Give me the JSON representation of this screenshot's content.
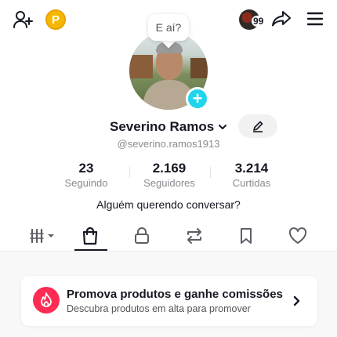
{
  "header": {
    "coin_symbol": "P",
    "story_count": "99",
    "icons": [
      "add-user-icon",
      "coin-icon",
      "share-icon",
      "menu-icon"
    ]
  },
  "profile": {
    "status_bubble": "E aí?",
    "name": "Severino Ramos",
    "username": "@severino.ramos1913",
    "bio": "Alguém querendo conversar?"
  },
  "stats": [
    {
      "value": "23",
      "label": "Seguindo"
    },
    {
      "value": "2.169",
      "label": "Seguidores"
    },
    {
      "value": "3.214",
      "label": "Curtidas"
    }
  ],
  "tabs": [
    "videos-grid-icon",
    "shop-bag-icon",
    "lock-icon",
    "repost-icon",
    "bookmark-icon",
    "heart-icon"
  ],
  "promo": {
    "title": "Promova produtos e ganhe comissões",
    "subtitle": "Descubra produtos em alta para promover"
  },
  "colors": {
    "accent_blue": "#20d5ec",
    "brand_red": "#fe2c55",
    "coin_yellow": "#f5b800",
    "text_primary": "#161823",
    "text_secondary": "#8a8b91"
  }
}
